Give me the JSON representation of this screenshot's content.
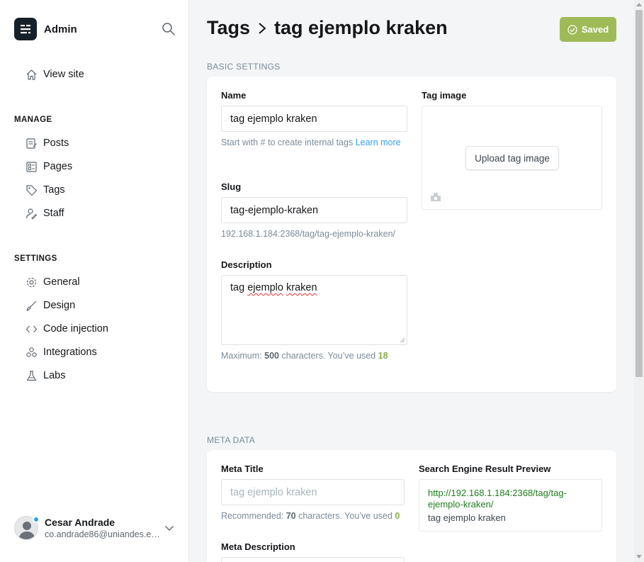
{
  "sidebar": {
    "brand": "Admin",
    "view_site": "View site",
    "manage_heading": "MANAGE",
    "manage_items": [
      "Posts",
      "Pages",
      "Tags",
      "Staff"
    ],
    "settings_heading": "SETTINGS",
    "settings_items": [
      "General",
      "Design",
      "Code injection",
      "Integrations",
      "Labs"
    ],
    "user": {
      "name": "Cesar Andrade",
      "email": "co.andrade86@uniandes.edu.co"
    }
  },
  "header": {
    "crumb_parent": "Tags",
    "crumb_current": "tag ejemplo kraken",
    "saved_label": "Saved"
  },
  "basic": {
    "section_label": "BASIC SETTINGS",
    "name_label": "Name",
    "name_value": "tag ejemplo kraken",
    "name_help": "Start with # to create internal tags ",
    "name_help_link": "Learn more",
    "slug_label": "Slug",
    "slug_value": "tag-ejemplo-kraken",
    "slug_url": "192.168.1.184:2368/tag/tag-ejemplo-kraken/",
    "description_label": "Description",
    "description_value_word1": "tag ",
    "description_value_word2": "ejemplo",
    "description_value_word3": " ",
    "description_value_word4": "kraken",
    "desc_help_prefix": "Maximum: ",
    "desc_help_max": "500",
    "desc_help_middle": " characters. You’ve used ",
    "desc_help_used": "18",
    "tag_image_label": "Tag image",
    "upload_label": "Upload tag image"
  },
  "meta": {
    "section_label": "META DATA",
    "title_label": "Meta Title",
    "title_placeholder": "tag ejemplo kraken",
    "title_help_prefix": "Recommended: ",
    "title_help_rec": "70",
    "title_help_middle": " characters. You’ve used ",
    "title_help_used": "0",
    "description_label": "Meta Description",
    "serp_label": "Search Engine Result Preview",
    "serp_url": "http://192.168.1.184:2368/tag/tag-ejemplo-kraken/",
    "serp_title": "tag ejemplo kraken"
  },
  "colors": {
    "saved_green": "#9fbb58",
    "link_blue": "#30a0ea",
    "count_green": "#8bb04a"
  }
}
